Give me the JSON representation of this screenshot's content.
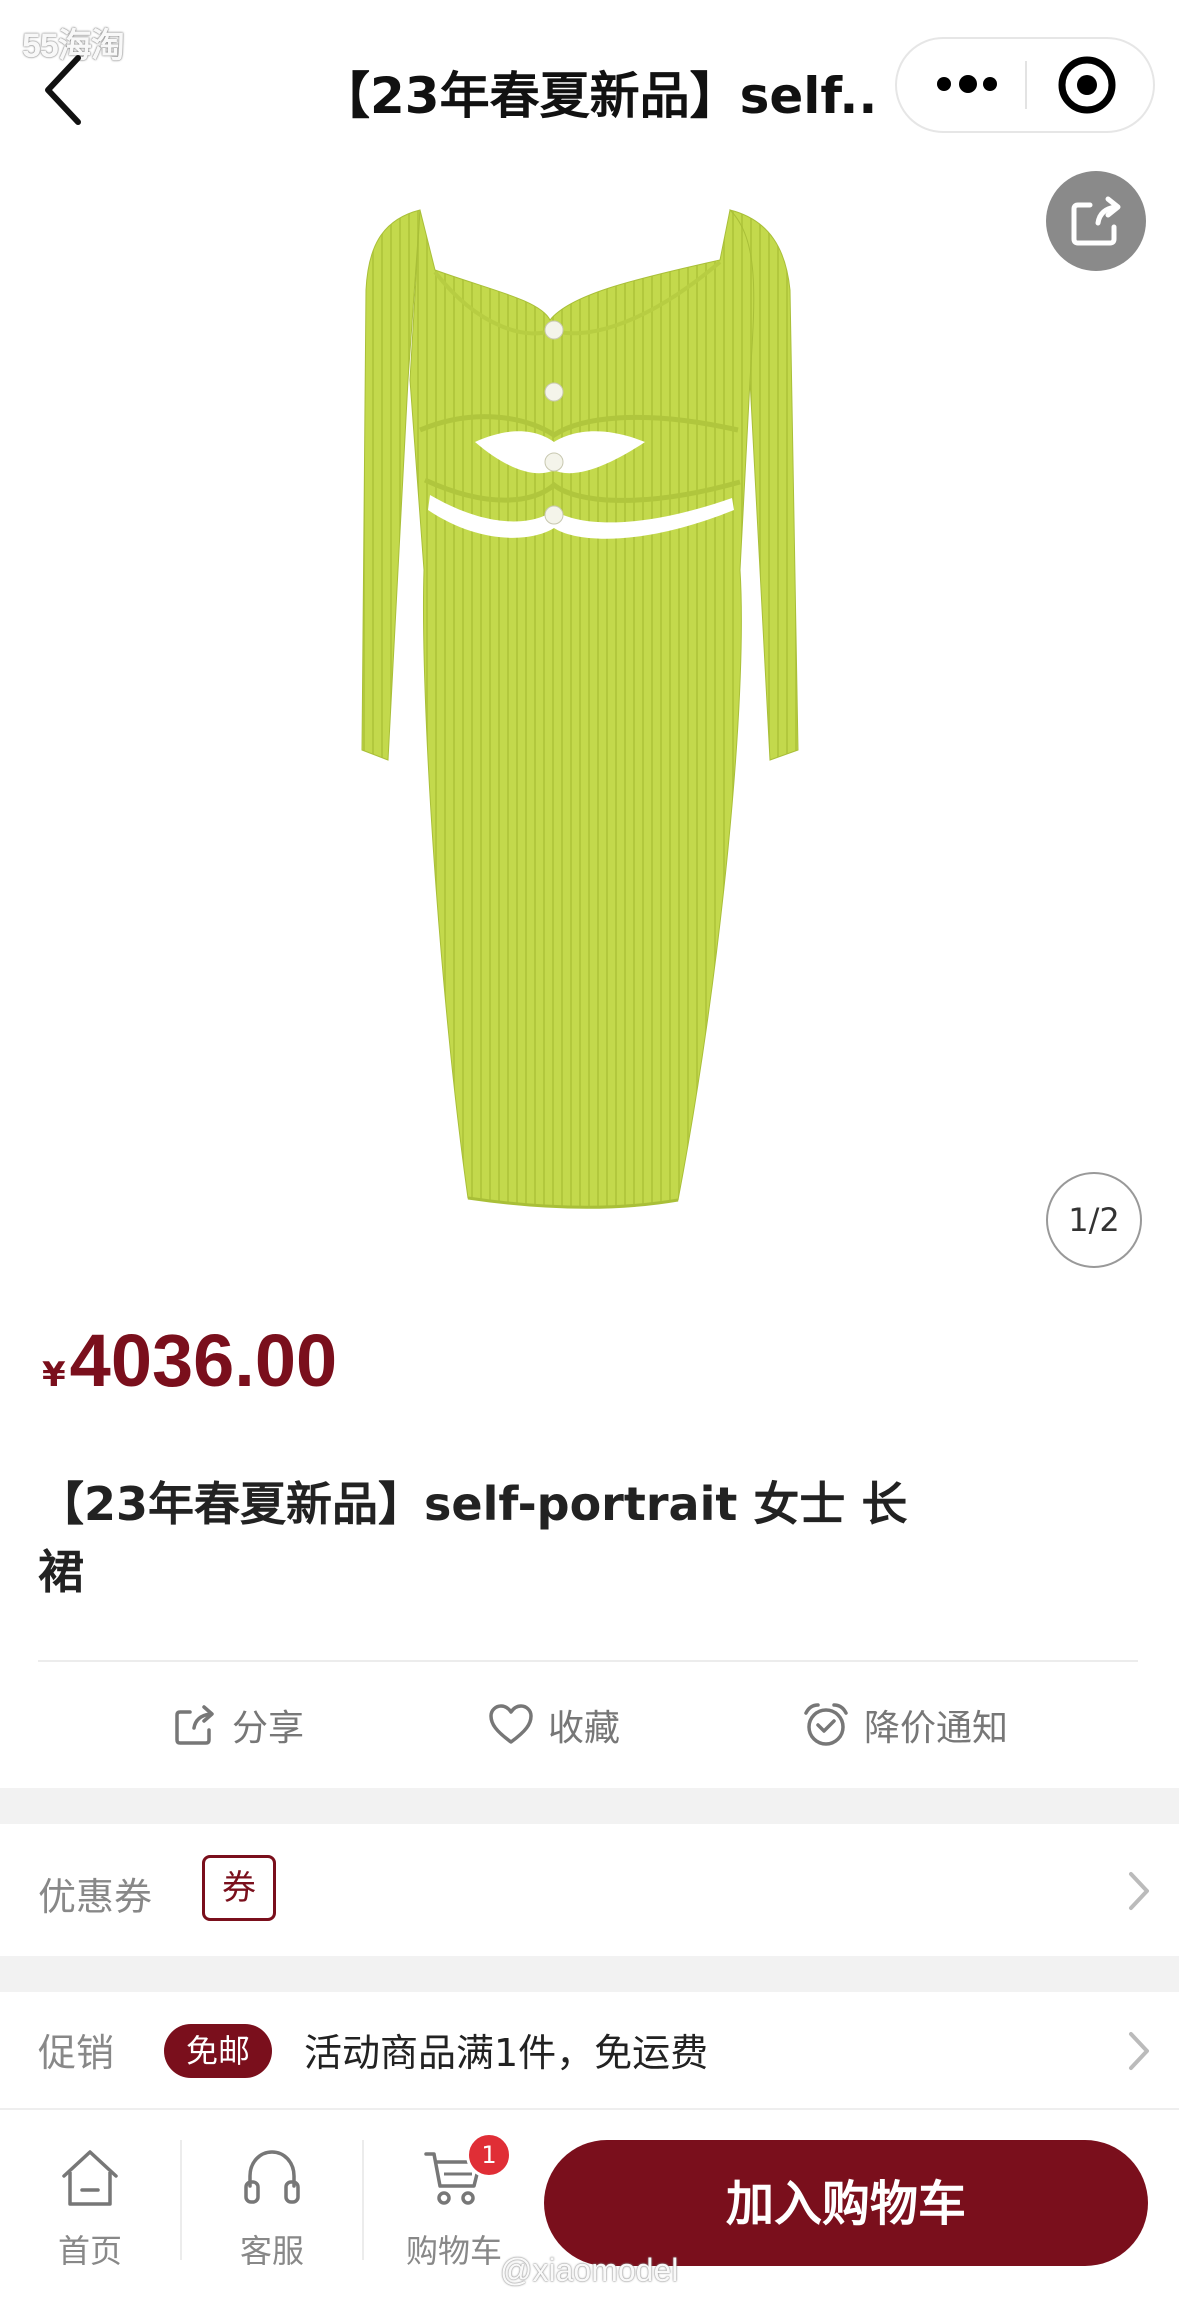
{
  "watermark": {
    "top": "55海淘",
    "bottom": "@xiaomodel"
  },
  "nav": {
    "title": "【23年春夏新品】self..."
  },
  "gallery": {
    "indicator": "1/2"
  },
  "price": {
    "currency": "¥",
    "amount": "4036.00"
  },
  "product": {
    "title": "【23年春夏新品】self-portrait 女士 长裙"
  },
  "actions": {
    "share": "分享",
    "favorite": "收藏",
    "price_alert": "降价通知"
  },
  "coupon": {
    "label": "优惠券",
    "tag": "券"
  },
  "promotion": {
    "label": "促销",
    "tag": "免邮",
    "text": "活动商品满1件，免运费"
  },
  "tabbar": {
    "home": "首页",
    "service": "客服",
    "cart": "购物车",
    "cart_badge": "1",
    "add_to_cart": "加入购物车"
  },
  "colors": {
    "brand": "#7a0f1c",
    "badge": "#e02e36",
    "dress": "#c2d94a"
  }
}
